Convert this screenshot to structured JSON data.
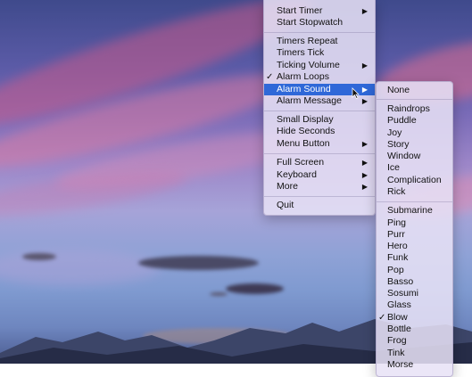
{
  "main_menu": {
    "items": [
      {
        "label": "Start Timer",
        "submenu": true
      },
      {
        "label": "Start Stopwatch"
      },
      {
        "label": "Timers Repeat"
      },
      {
        "label": "Timers Tick"
      },
      {
        "label": "Ticking Volume",
        "submenu": true
      },
      {
        "label": "Alarm Loops",
        "checked": true
      },
      {
        "label": "Alarm Sound",
        "submenu": true,
        "highlighted": true
      },
      {
        "label": "Alarm Message",
        "submenu": true
      },
      {
        "label": "Small Display"
      },
      {
        "label": "Hide Seconds"
      },
      {
        "label": "Menu Button",
        "submenu": true
      },
      {
        "label": "Full Screen",
        "submenu": true
      },
      {
        "label": "Keyboard",
        "submenu": true
      },
      {
        "label": "More",
        "submenu": true
      },
      {
        "label": "Quit"
      }
    ]
  },
  "sound_menu": {
    "items": [
      {
        "label": "None"
      },
      {
        "label": "Raindrops"
      },
      {
        "label": "Puddle"
      },
      {
        "label": "Joy"
      },
      {
        "label": "Story"
      },
      {
        "label": "Window"
      },
      {
        "label": "Ice"
      },
      {
        "label": "Complication"
      },
      {
        "label": "Rick"
      },
      {
        "label": "Submarine"
      },
      {
        "label": "Ping"
      },
      {
        "label": "Purr"
      },
      {
        "label": "Hero"
      },
      {
        "label": "Funk"
      },
      {
        "label": "Pop"
      },
      {
        "label": "Basso"
      },
      {
        "label": "Sosumi"
      },
      {
        "label": "Glass"
      },
      {
        "label": "Blow",
        "checked": true
      },
      {
        "label": "Bottle"
      },
      {
        "label": "Frog"
      },
      {
        "label": "Tink"
      },
      {
        "label": "Morse"
      }
    ]
  },
  "glyphs": {
    "check": "✓",
    "arrow": "▶"
  },
  "colors": {
    "highlight": "#2f68d8",
    "menu_bg": "#e8e2f6"
  }
}
